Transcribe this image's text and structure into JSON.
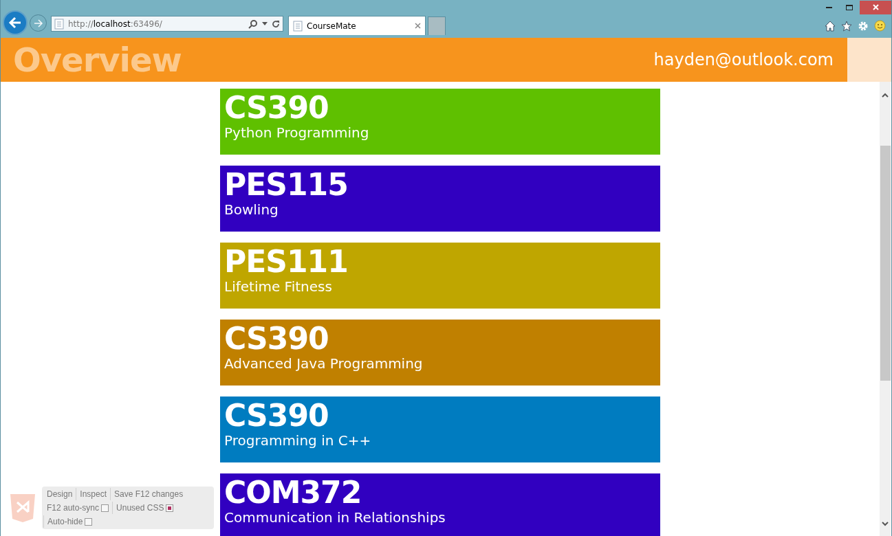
{
  "browser": {
    "address": {
      "prefix": "http://",
      "host": "localhost",
      "suffix": ":63496/"
    },
    "tabs": [
      {
        "title": "CourseMate",
        "selected": true
      }
    ]
  },
  "header": {
    "title": "Overview",
    "user": "hayden@outlook.com"
  },
  "courses": [
    {
      "code": "CS390",
      "name": "Python Programming",
      "color": "#5fc000"
    },
    {
      "code": "PES115",
      "name": "Bowling",
      "color": "#3100c0"
    },
    {
      "code": "PES111",
      "name": "Lifetime Fitness",
      "color": "#bfa600"
    },
    {
      "code": "CS390",
      "name": "Advanced Java Programming",
      "color": "#c08000"
    },
    {
      "code": "CS390",
      "name": "Programming in C++",
      "color": "#007cc0"
    },
    {
      "code": "COM372",
      "name": "Communication in Relationships",
      "color": "#3100c0"
    }
  ],
  "devtools_bar": {
    "items": [
      {
        "label": "Design",
        "kind": "button"
      },
      {
        "label": "Inspect",
        "kind": "button"
      },
      {
        "label": "Save F12 changes",
        "kind": "button"
      },
      {
        "label": "F12 auto-sync",
        "kind": "toggle",
        "checked": false
      },
      {
        "label": "Unused CSS",
        "kind": "toggle",
        "checked": true
      },
      {
        "label": "Auto-hide",
        "kind": "toggle",
        "checked": false
      }
    ]
  }
}
